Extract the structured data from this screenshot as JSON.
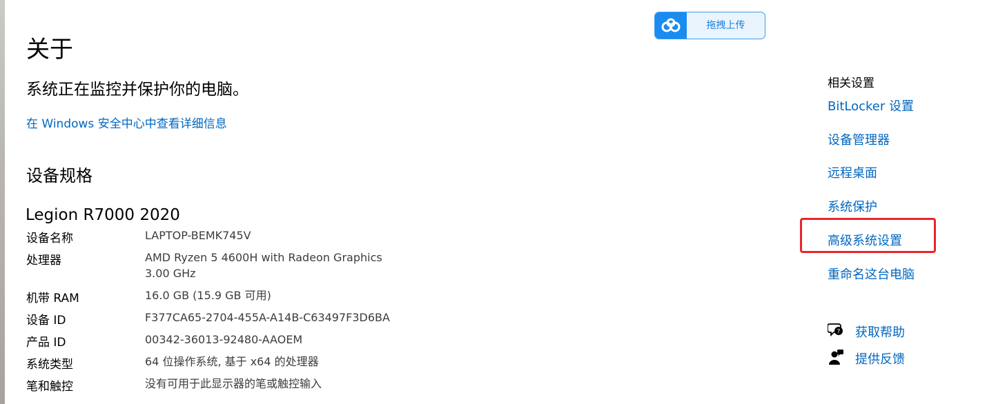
{
  "page": {
    "title": "关于",
    "status": "系统正在监控并保护你的电脑。",
    "security_link": "在 Windows 安全中心中查看详细信息"
  },
  "upload_button": {
    "label": "拖拽上传",
    "icon": "cloud-icon",
    "accent": "#1a8cf0"
  },
  "device_specs": {
    "heading": "设备规格",
    "model": "Legion R7000 2020",
    "rows": [
      {
        "label": "设备名称",
        "value": "LAPTOP-BEMK745V"
      },
      {
        "label": "处理器",
        "value": "AMD Ryzen 5 4600H with Radeon Graphics",
        "value2": "3.00 GHz"
      },
      {
        "label": "机带 RAM",
        "value": "16.0 GB (15.9 GB 可用)"
      },
      {
        "label": "设备 ID",
        "value": "F377CA65-2704-455A-A14B-C63497F3D6BA"
      },
      {
        "label": "产品 ID",
        "value": "00342-36013-92480-AAOEM"
      },
      {
        "label": "系统类型",
        "value": "64 位操作系统, 基于 x64 的处理器"
      },
      {
        "label": "笔和触控",
        "value": "没有可用于此显示器的笔或触控输入"
      }
    ]
  },
  "related_settings": {
    "heading": "相关设置",
    "links": [
      {
        "label": "BitLocker 设置"
      },
      {
        "label": "设备管理器"
      },
      {
        "label": "远程桌面"
      },
      {
        "label": "系统保护"
      },
      {
        "label": "高级系统设置",
        "highlighted": true
      },
      {
        "label": "重命名这台电脑"
      }
    ]
  },
  "help": {
    "get_help": {
      "label": "获取帮助",
      "icon": "chat-help-icon"
    },
    "feedback": {
      "label": "提供反馈",
      "icon": "feedback-person-icon"
    }
  },
  "colors": {
    "link": "#0067c0",
    "highlight": "#e8252b"
  }
}
